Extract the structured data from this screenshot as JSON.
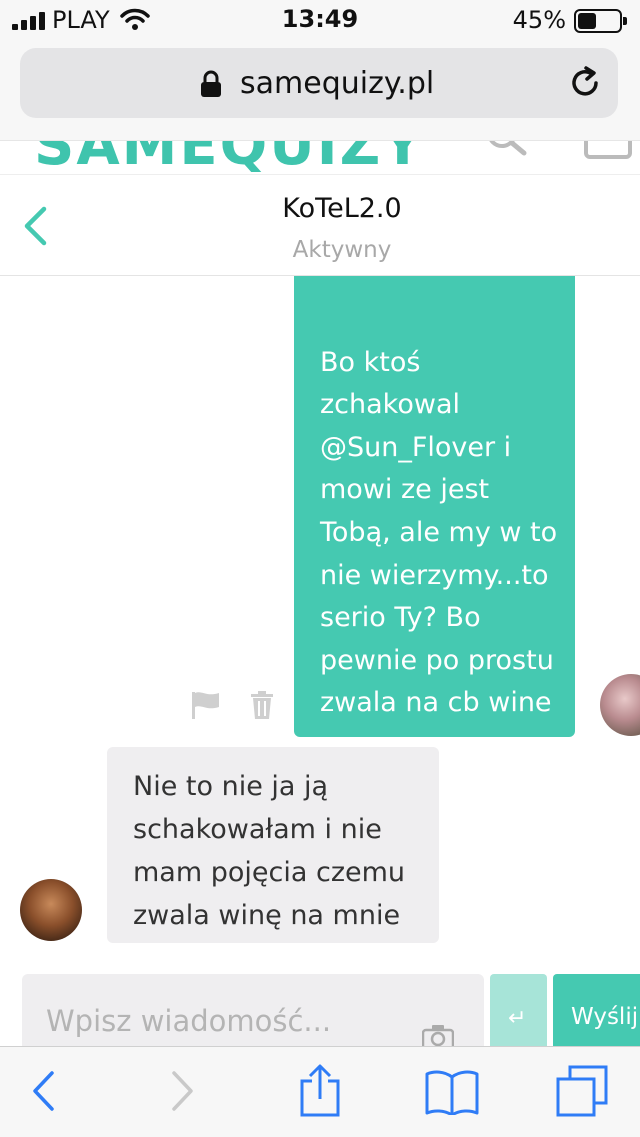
{
  "status_bar": {
    "carrier": "PLAY",
    "time": "13:49",
    "battery": "45%"
  },
  "browser": {
    "url": "samequizy.pl"
  },
  "site": {
    "logo": "SAMEQUIZY"
  },
  "chat": {
    "contact_name": "KoTeL2.0",
    "contact_status": "Aktywny"
  },
  "messages": [
    {
      "direction": "outgoing",
      "text": "Bo ktoś zchakowal @Sun_Flover i mowi ze jest Tobą, ale my w to nie wierzymy...to serio Ty? Bo pewnie po prostu zwala na cb wine"
    },
    {
      "direction": "incoming",
      "text": "Nie to nie ja ją schakowałam i nie mam pojęcia czemu zwala winę na mnie"
    }
  ],
  "composer": {
    "placeholder": "Wpisz wiadomość...",
    "send_label": "Wyślij"
  },
  "colors": {
    "accent": "#45c9b1",
    "accent_light": "#a7e4d8",
    "incoming_bubble": "#efeef0",
    "ios_blue": "#2f7cf6"
  },
  "icons": [
    "signal-icon",
    "wifi-icon",
    "battery-icon",
    "lock-icon",
    "reload-icon",
    "search-icon",
    "back-chevron-icon",
    "flag-icon",
    "trash-icon",
    "camera-icon",
    "enter-icon",
    "share-icon",
    "bookmarks-icon",
    "tabs-icon"
  ]
}
